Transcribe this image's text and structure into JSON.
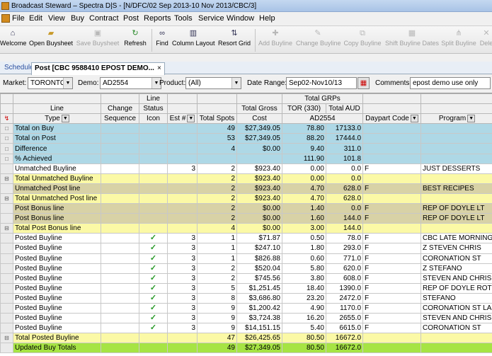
{
  "window": {
    "title": "Broadcast Steward – Spectra D|S - [N/DFC/02 Sep 2013-10 Nov 2013/CBC/3]"
  },
  "menu": [
    "File",
    "Edit",
    "View",
    "Buy",
    "Contract",
    "Post",
    "Reports",
    "Tools",
    "Service",
    "Window",
    "Help"
  ],
  "toolbar": [
    {
      "label": "Welcome",
      "icon": "home-icon",
      "enabled": true
    },
    {
      "label": "Open Buysheet",
      "icon": "folder-open-icon",
      "enabled": true
    },
    {
      "label": "Save Buysheet",
      "icon": "save-icon",
      "enabled": false
    },
    {
      "label": "Refresh",
      "icon": "refresh-icon",
      "enabled": true
    },
    {
      "label": "Find",
      "icon": "binoculars-icon",
      "enabled": true
    },
    {
      "label": "Column Layout",
      "icon": "column-layout-icon",
      "enabled": true
    },
    {
      "label": "Resort Grid",
      "icon": "sort-icon",
      "enabled": true
    },
    {
      "label": "Add Buyline",
      "icon": "plus-icon",
      "enabled": false
    },
    {
      "label": "Change Buyline",
      "icon": "pencil-icon",
      "enabled": false
    },
    {
      "label": "Copy Buyline",
      "icon": "copy-icon",
      "enabled": false
    },
    {
      "label": "Shift Buyline Dates",
      "icon": "calendar-shift-icon",
      "enabled": false
    },
    {
      "label": "Split Buyline",
      "icon": "split-icon",
      "enabled": false
    },
    {
      "label": "Dele",
      "icon": "delete-icon",
      "enabled": false
    }
  ],
  "tabs": [
    {
      "label": "Schedule",
      "active": false
    },
    {
      "label": "Post [CBC 9588410 EPOST DEMO...",
      "active": true
    }
  ],
  "filters": {
    "market_label": "Market:",
    "market_value": "TORONTO",
    "demo_label": "Demo:",
    "demo_value": "AD2554",
    "product_label": "Product:",
    "product_value": "(All)",
    "daterange_label": "Date Range:",
    "daterange_value": "Sep02-Nov10/13",
    "comments_label": "Comments:",
    "comments_value": "epost demo use only"
  },
  "grid": {
    "header1": {
      "line": "",
      "change": "",
      "status": "Line",
      "grps": "Total GRPs"
    },
    "header2": {
      "line": "Line",
      "change": "Change",
      "status": "Status",
      "grosscost": "Total Gross",
      "tor": "TOR (330)",
      "aud": "Total AUD"
    },
    "header3": {
      "type": "Type",
      "sequence": "Sequence",
      "icon": "Icon",
      "est": "Est #",
      "spots": "Total Spots",
      "cost": "Cost",
      "demo": "AD2554",
      "daypart": "Daypart Code",
      "program": "Program"
    },
    "rows": [
      {
        "style": "blue",
        "ind": "□",
        "type": "Total on Buy",
        "seq": "",
        "check": false,
        "est": "",
        "spots": "49",
        "cost": "$27,349.05",
        "tor": "78.80",
        "aud": "17133.0",
        "daypart": "",
        "program": ""
      },
      {
        "style": "blue",
        "ind": "□",
        "type": "Total on Post",
        "seq": "",
        "check": false,
        "est": "",
        "spots": "53",
        "cost": "$27,349.05",
        "tor": "88.20",
        "aud": "17444.0",
        "daypart": "",
        "program": ""
      },
      {
        "style": "blue",
        "ind": "□",
        "type": "Difference",
        "seq": "",
        "check": false,
        "est": "",
        "spots": "4",
        "cost": "$0.00",
        "tor": "9.40",
        "aud": "311.0",
        "daypart": "",
        "program": ""
      },
      {
        "style": "blue",
        "ind": "□",
        "type": "% Achieved",
        "seq": "",
        "check": false,
        "est": "",
        "spots": "",
        "cost": "",
        "tor": "111.90",
        "aud": "101.8",
        "daypart": "",
        "program": ""
      },
      {
        "style": "white",
        "ind": "",
        "type": "Unmatched Buyline",
        "seq": "",
        "check": false,
        "est": "3",
        "spots": "2",
        "cost": "$923.40",
        "tor": "0.00",
        "aud": "0.0",
        "daypart": "F",
        "program": "JUST DESSERTS"
      },
      {
        "style": "yellow",
        "ind": "⊟",
        "type": "Total Unmatched Buyline",
        "seq": "",
        "check": false,
        "est": "",
        "spots": "2",
        "cost": "$923.40",
        "tor": "0.00",
        "aud": "0.0",
        "daypart": "",
        "program": ""
      },
      {
        "style": "tan",
        "ind": "",
        "type": "Unmatched Post line",
        "seq": "",
        "check": false,
        "est": "",
        "spots": "2",
        "cost": "$923.40",
        "tor": "4.70",
        "aud": "628.0",
        "daypart": "F",
        "program": "BEST RECIPES"
      },
      {
        "style": "yellow",
        "ind": "⊟",
        "type": "Total Unmatched Post line",
        "seq": "",
        "check": false,
        "est": "",
        "spots": "2",
        "cost": "$923.40",
        "tor": "4.70",
        "aud": "628.0",
        "daypart": "",
        "program": ""
      },
      {
        "style": "tan",
        "ind": "",
        "type": "Post Bonus line",
        "seq": "",
        "check": false,
        "est": "",
        "spots": "2",
        "cost": "$0.00",
        "tor": "1.40",
        "aud": "0.0",
        "daypart": "F",
        "program": "REP OF DOYLE LT"
      },
      {
        "style": "tan",
        "ind": "",
        "type": "Post Bonus line",
        "seq": "",
        "check": false,
        "est": "",
        "spots": "2",
        "cost": "$0.00",
        "tor": "1.60",
        "aud": "144.0",
        "daypart": "F",
        "program": "REP OF DOYLE LT"
      },
      {
        "style": "yellow",
        "ind": "⊟",
        "type": "Total Post Bonus line",
        "seq": "",
        "check": false,
        "est": "",
        "spots": "4",
        "cost": "$0.00",
        "tor": "3.00",
        "aud": "144.0",
        "daypart": "",
        "program": ""
      },
      {
        "style": "white",
        "ind": "",
        "type": "Posted Buyline",
        "seq": "",
        "check": true,
        "est": "3",
        "spots": "1",
        "cost": "$71.87",
        "tor": "0.50",
        "aud": "78.0",
        "daypart": "F",
        "program": "CBC LATE MORNING"
      },
      {
        "style": "white",
        "ind": "",
        "type": "Posted Buyline",
        "seq": "",
        "check": true,
        "est": "3",
        "spots": "1",
        "cost": "$247.10",
        "tor": "1.80",
        "aud": "293.0",
        "daypart": "F",
        "program": "Z STEVEN  CHRIS"
      },
      {
        "style": "white",
        "ind": "",
        "type": "Posted Buyline",
        "seq": "",
        "check": true,
        "est": "3",
        "spots": "1",
        "cost": "$826.88",
        "tor": "0.60",
        "aud": "771.0",
        "daypart": "F",
        "program": "CORONATION ST"
      },
      {
        "style": "white",
        "ind": "",
        "type": "Posted Buyline",
        "seq": "",
        "check": true,
        "est": "3",
        "spots": "2",
        "cost": "$520.04",
        "tor": "5.80",
        "aud": "620.0",
        "daypart": "F",
        "program": "Z STEFANO"
      },
      {
        "style": "white",
        "ind": "",
        "type": "Posted Buyline",
        "seq": "",
        "check": true,
        "est": "3",
        "spots": "2",
        "cost": "$745.56",
        "tor": "3.80",
        "aud": "608.0",
        "daypart": "F",
        "program": "STEVEN AND CHRIS"
      },
      {
        "style": "white",
        "ind": "",
        "type": "Posted Buyline",
        "seq": "",
        "check": true,
        "est": "3",
        "spots": "5",
        "cost": "$1,251.45",
        "tor": "18.40",
        "aud": "1390.0",
        "daypart": "F",
        "program": "REP OF DOYLE ROT"
      },
      {
        "style": "white",
        "ind": "",
        "type": "Posted Buyline",
        "seq": "",
        "check": true,
        "est": "3",
        "spots": "8",
        "cost": "$3,686.80",
        "tor": "23.20",
        "aud": "2472.0",
        "daypart": "F",
        "program": "STEFANO"
      },
      {
        "style": "white",
        "ind": "",
        "type": "Posted Buyline",
        "seq": "",
        "check": true,
        "est": "3",
        "spots": "9",
        "cost": "$1,200.42",
        "tor": "4.90",
        "aud": "1170.0",
        "daypart": "F",
        "program": "CORONATION ST LA"
      },
      {
        "style": "white",
        "ind": "",
        "type": "Posted Buyline",
        "seq": "",
        "check": true,
        "est": "3",
        "spots": "9",
        "cost": "$3,724.38",
        "tor": "16.20",
        "aud": "2655.0",
        "daypart": "F",
        "program": "STEVEN AND CHRIS"
      },
      {
        "style": "white",
        "ind": "",
        "type": "Posted Buyline",
        "seq": "",
        "check": true,
        "est": "3",
        "spots": "9",
        "cost": "$14,151.15",
        "tor": "5.40",
        "aud": "6615.0",
        "daypart": "F",
        "program": "CORONATION ST"
      },
      {
        "style": "yellow",
        "ind": "⊟",
        "type": "Total Posted Buyline",
        "seq": "",
        "check": false,
        "est": "",
        "spots": "47",
        "cost": "$26,425.65",
        "tor": "80.50",
        "aud": "16672.0",
        "daypart": "",
        "program": ""
      },
      {
        "style": "green",
        "ind": "",
        "type": "Updated Buy Totals",
        "seq": "",
        "check": false,
        "est": "",
        "spots": "49",
        "cost": "$27,349.05",
        "tor": "80.50",
        "aud": "16672.0",
        "daypart": "",
        "program": ""
      }
    ]
  }
}
